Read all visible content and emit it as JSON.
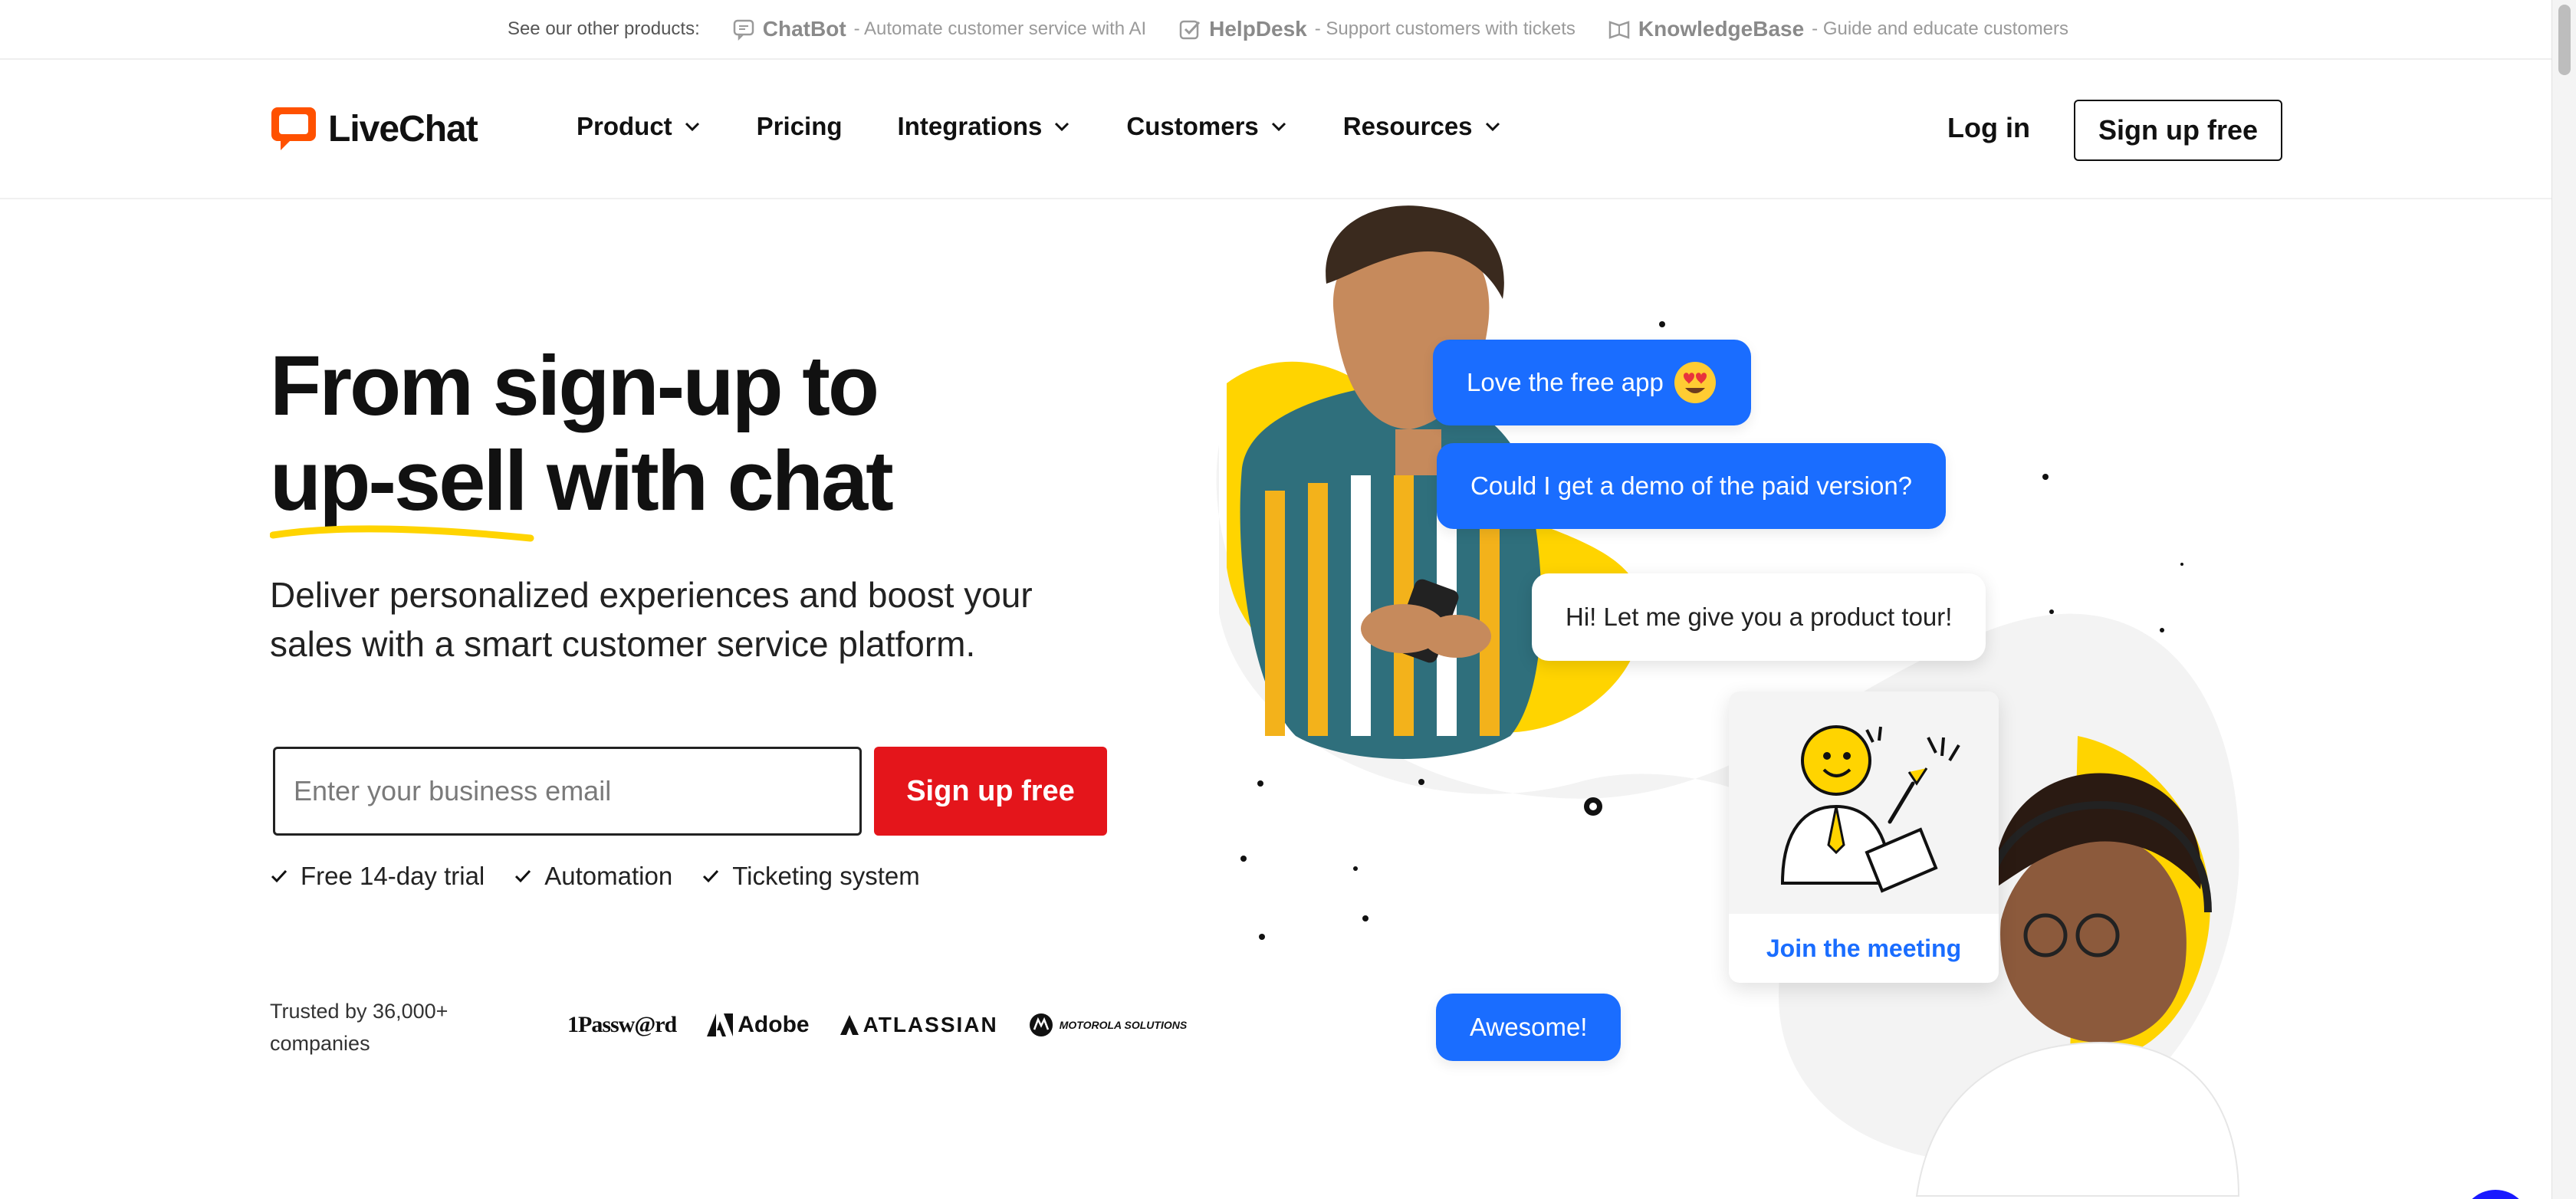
{
  "topbar": {
    "intro": "See our other products:",
    "products": [
      {
        "name": "ChatBot",
        "desc": "- Automate customer service with AI",
        "icon": "chatbot-icon"
      },
      {
        "name": "HelpDesk",
        "desc": "- Support customers with tickets",
        "icon": "helpdesk-icon"
      },
      {
        "name": "KnowledgeBase",
        "desc": "- Guide and educate customers",
        "icon": "knowledgebase-icon"
      }
    ]
  },
  "nav": {
    "logo_text": "LiveChat",
    "menu": [
      {
        "label": "Product",
        "dropdown": true
      },
      {
        "label": "Pricing",
        "dropdown": false
      },
      {
        "label": "Integrations",
        "dropdown": true
      },
      {
        "label": "Customers",
        "dropdown": true
      },
      {
        "label": "Resources",
        "dropdown": true
      }
    ],
    "login": "Log in",
    "signup": "Sign up free"
  },
  "hero": {
    "headline_line1": "From sign-up to",
    "headline_line2_a": "up-sell",
    "headline_line2_b": " with chat",
    "subtitle": "Deliver personalized experiences and boost your sales with a smart customer service platform.",
    "email_placeholder": "Enter your business email",
    "cta": "Sign up free",
    "features": [
      "Free 14-day trial",
      "Automation",
      "Ticketing system"
    ],
    "trusted": "Trusted by 36,000+ companies",
    "logos": [
      "1Passw@rd",
      "Adobe",
      "ATLASSIAN",
      "MOTOROLA SOLUTIONS"
    ]
  },
  "illustration": {
    "bubbles": {
      "b1": "Love the free app",
      "b2": "Could I get a demo of the paid version?",
      "b3": "Hi! Let me give you a product tour!",
      "b4": "Awesome!"
    },
    "meeting_card": "Join the meeting"
  },
  "colors": {
    "brand_orange": "#ff5100",
    "cta_red": "#e4151b",
    "bubble_blue": "#1a6dff",
    "accent_yellow": "#ffd400"
  }
}
